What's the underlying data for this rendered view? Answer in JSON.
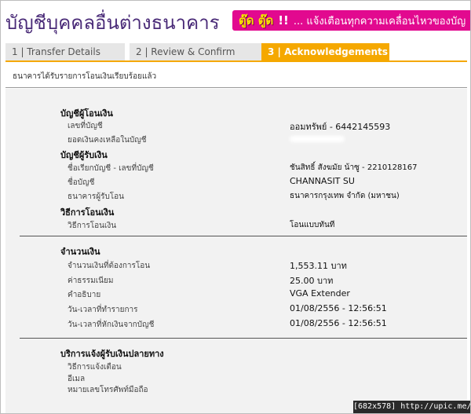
{
  "header": {
    "title": "บัญชีบุคคลอื่นต่างธนาคาร",
    "banner_logo": "ตู๊ด ตู๊ด",
    "banner_sep": "!!",
    "banner_msg": "... แจ้งเตือนทุกความเคลื่อนไหวของบัญ"
  },
  "tabs": [
    {
      "label": "1 | Transfer Details"
    },
    {
      "label": "2 | Review & Confirm"
    },
    {
      "label": "3 | Acknowledgements"
    }
  ],
  "notice": "ธนาคารได้รับรายการโอนเงินเรียบร้อยแล้ว",
  "from_account": {
    "heading": "บัญชีผู้โอนเงิน",
    "account_no_label": "เลขที่บัญชี",
    "account_no_value": "ออมทรัพย์ - 6442145593",
    "balance_label": "ยอดเงินคงเหลือในบัญชี"
  },
  "to_account": {
    "heading": "บัญชีผู้รับเงิน",
    "name_no_label": "ชื่อเรียกบัญชี - เลขที่บัญชี",
    "name_no_value": "ชันสิทธิ์ สังฆมัย น้าซู - 2210128167",
    "account_name_label": "ชื่อบัญชี",
    "account_name_value": "CHANNASIT SU",
    "bank_label": "ธนาคารผู้รับโอน",
    "bank_value": "ธนาคารกรุงเทพ จำกัด (มหาชน)"
  },
  "method": {
    "heading": "วิธีการโอนเงิน",
    "label": "วิธีการโอนเงิน",
    "value": "โอนแบบทันที"
  },
  "amount": {
    "heading": "จำนวนเงิน",
    "transfer_label": "จำนวนเงินที่ต้องการโอน",
    "transfer_value": "1,553.11 บาท",
    "fee_label": "ค่าธรรมเนียม",
    "fee_value": "25.00 บาท",
    "desc_label": "คำอธิบาย",
    "desc_value": "VGA Extender",
    "txn_time_label": "วัน-เวลาที่ทำรายการ",
    "txn_time_value": "01/08/2556 - 12:56:51",
    "debit_time_label": "วัน-เวลาที่หักเงินจากบัญชี",
    "debit_time_value": "01/08/2556 - 12:56:51"
  },
  "notify": {
    "heading": "บริการแจ้งผู้รับเงินปลายทาง",
    "method_label": "วิธีการแจ้งเตือน",
    "email_label": "อีเมล",
    "phone_label": "หมายเลขโทรศัพท์มือถือ"
  },
  "footer": {
    "text": "[682x578] http://upic.me/"
  }
}
